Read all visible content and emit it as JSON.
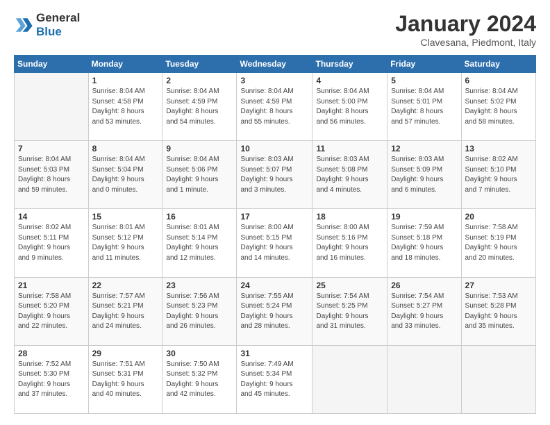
{
  "logo": {
    "line1": "General",
    "line2": "Blue"
  },
  "title": "January 2024",
  "location": "Clavesana, Piedmont, Italy",
  "weekdays": [
    "Sunday",
    "Monday",
    "Tuesday",
    "Wednesday",
    "Thursday",
    "Friday",
    "Saturday"
  ],
  "weeks": [
    [
      {
        "day": "",
        "info": ""
      },
      {
        "day": "1",
        "info": "Sunrise: 8:04 AM\nSunset: 4:58 PM\nDaylight: 8 hours\nand 53 minutes."
      },
      {
        "day": "2",
        "info": "Sunrise: 8:04 AM\nSunset: 4:59 PM\nDaylight: 8 hours\nand 54 minutes."
      },
      {
        "day": "3",
        "info": "Sunrise: 8:04 AM\nSunset: 4:59 PM\nDaylight: 8 hours\nand 55 minutes."
      },
      {
        "day": "4",
        "info": "Sunrise: 8:04 AM\nSunset: 5:00 PM\nDaylight: 8 hours\nand 56 minutes."
      },
      {
        "day": "5",
        "info": "Sunrise: 8:04 AM\nSunset: 5:01 PM\nDaylight: 8 hours\nand 57 minutes."
      },
      {
        "day": "6",
        "info": "Sunrise: 8:04 AM\nSunset: 5:02 PM\nDaylight: 8 hours\nand 58 minutes."
      }
    ],
    [
      {
        "day": "7",
        "info": "Sunrise: 8:04 AM\nSunset: 5:03 PM\nDaylight: 8 hours\nand 59 minutes."
      },
      {
        "day": "8",
        "info": "Sunrise: 8:04 AM\nSunset: 5:04 PM\nDaylight: 9 hours\nand 0 minutes."
      },
      {
        "day": "9",
        "info": "Sunrise: 8:04 AM\nSunset: 5:06 PM\nDaylight: 9 hours\nand 1 minute."
      },
      {
        "day": "10",
        "info": "Sunrise: 8:03 AM\nSunset: 5:07 PM\nDaylight: 9 hours\nand 3 minutes."
      },
      {
        "day": "11",
        "info": "Sunrise: 8:03 AM\nSunset: 5:08 PM\nDaylight: 9 hours\nand 4 minutes."
      },
      {
        "day": "12",
        "info": "Sunrise: 8:03 AM\nSunset: 5:09 PM\nDaylight: 9 hours\nand 6 minutes."
      },
      {
        "day": "13",
        "info": "Sunrise: 8:02 AM\nSunset: 5:10 PM\nDaylight: 9 hours\nand 7 minutes."
      }
    ],
    [
      {
        "day": "14",
        "info": "Sunrise: 8:02 AM\nSunset: 5:11 PM\nDaylight: 9 hours\nand 9 minutes."
      },
      {
        "day": "15",
        "info": "Sunrise: 8:01 AM\nSunset: 5:12 PM\nDaylight: 9 hours\nand 11 minutes."
      },
      {
        "day": "16",
        "info": "Sunrise: 8:01 AM\nSunset: 5:14 PM\nDaylight: 9 hours\nand 12 minutes."
      },
      {
        "day": "17",
        "info": "Sunrise: 8:00 AM\nSunset: 5:15 PM\nDaylight: 9 hours\nand 14 minutes."
      },
      {
        "day": "18",
        "info": "Sunrise: 8:00 AM\nSunset: 5:16 PM\nDaylight: 9 hours\nand 16 minutes."
      },
      {
        "day": "19",
        "info": "Sunrise: 7:59 AM\nSunset: 5:18 PM\nDaylight: 9 hours\nand 18 minutes."
      },
      {
        "day": "20",
        "info": "Sunrise: 7:58 AM\nSunset: 5:19 PM\nDaylight: 9 hours\nand 20 minutes."
      }
    ],
    [
      {
        "day": "21",
        "info": "Sunrise: 7:58 AM\nSunset: 5:20 PM\nDaylight: 9 hours\nand 22 minutes."
      },
      {
        "day": "22",
        "info": "Sunrise: 7:57 AM\nSunset: 5:21 PM\nDaylight: 9 hours\nand 24 minutes."
      },
      {
        "day": "23",
        "info": "Sunrise: 7:56 AM\nSunset: 5:23 PM\nDaylight: 9 hours\nand 26 minutes."
      },
      {
        "day": "24",
        "info": "Sunrise: 7:55 AM\nSunset: 5:24 PM\nDaylight: 9 hours\nand 28 minutes."
      },
      {
        "day": "25",
        "info": "Sunrise: 7:54 AM\nSunset: 5:25 PM\nDaylight: 9 hours\nand 31 minutes."
      },
      {
        "day": "26",
        "info": "Sunrise: 7:54 AM\nSunset: 5:27 PM\nDaylight: 9 hours\nand 33 minutes."
      },
      {
        "day": "27",
        "info": "Sunrise: 7:53 AM\nSunset: 5:28 PM\nDaylight: 9 hours\nand 35 minutes."
      }
    ],
    [
      {
        "day": "28",
        "info": "Sunrise: 7:52 AM\nSunset: 5:30 PM\nDaylight: 9 hours\nand 37 minutes."
      },
      {
        "day": "29",
        "info": "Sunrise: 7:51 AM\nSunset: 5:31 PM\nDaylight: 9 hours\nand 40 minutes."
      },
      {
        "day": "30",
        "info": "Sunrise: 7:50 AM\nSunset: 5:32 PM\nDaylight: 9 hours\nand 42 minutes."
      },
      {
        "day": "31",
        "info": "Sunrise: 7:49 AM\nSunset: 5:34 PM\nDaylight: 9 hours\nand 45 minutes."
      },
      {
        "day": "",
        "info": ""
      },
      {
        "day": "",
        "info": ""
      },
      {
        "day": "",
        "info": ""
      }
    ]
  ]
}
